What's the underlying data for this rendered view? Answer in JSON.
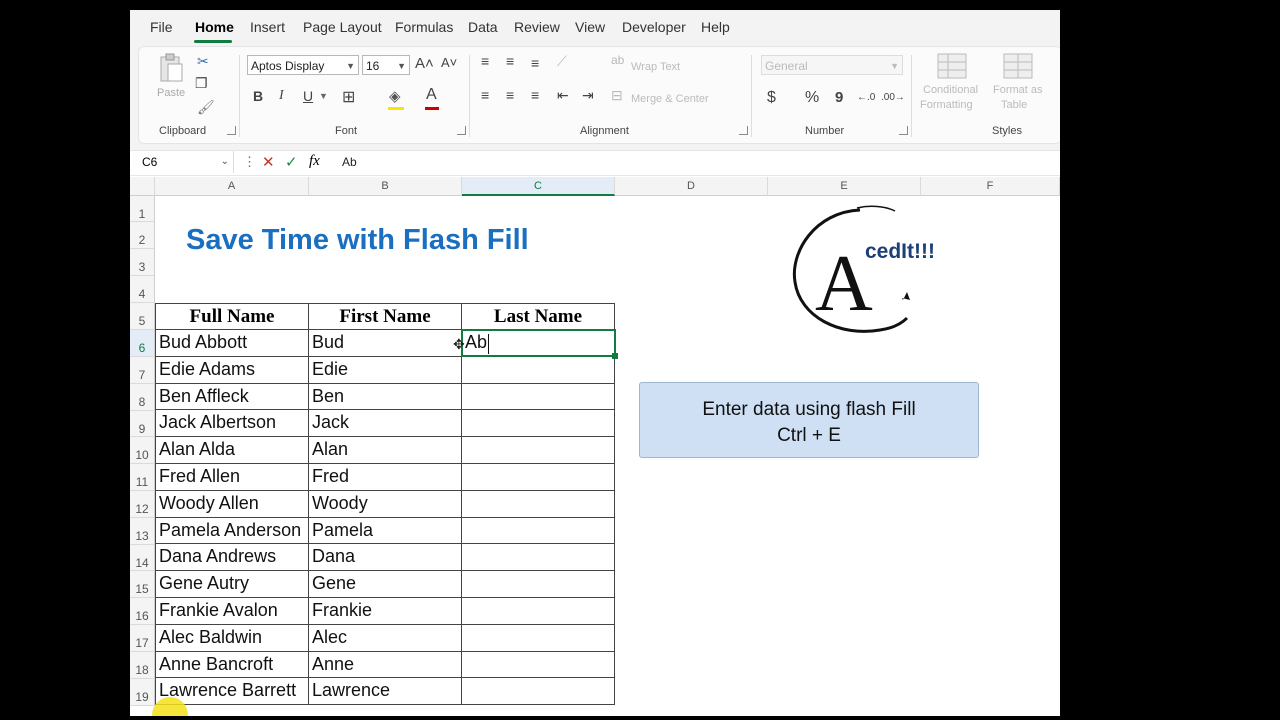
{
  "menu": {
    "tabs": [
      "File",
      "Home",
      "Insert",
      "Page Layout",
      "Formulas",
      "Data",
      "Review",
      "View",
      "Developer",
      "Help"
    ],
    "active": "Home"
  },
  "ribbon": {
    "clipboard": {
      "paste_label": "Paste",
      "group_label": "Clipboard"
    },
    "font": {
      "font_name": "Aptos Display",
      "font_size": "16",
      "bold": "B",
      "italic": "I",
      "underline": "U",
      "group_label": "Font"
    },
    "alignment": {
      "wrap_text": "Wrap Text",
      "merge_center": "Merge & Center",
      "group_label": "Alignment"
    },
    "number": {
      "format": "General",
      "currency": "$",
      "percent": "%",
      "comma": "9",
      "group_label": "Number"
    },
    "styles": {
      "conditional_line1": "Conditional",
      "conditional_line2": "Formatting",
      "format_table_line1": "Format as",
      "format_table_line2": "Table",
      "group_label": "Styles"
    }
  },
  "formula_bar": {
    "name_box": "C6",
    "cancel": "✕",
    "enter": "✓",
    "fx": "fx",
    "formula": "Ab"
  },
  "columns": [
    "A",
    "B",
    "C",
    "D",
    "E",
    "F"
  ],
  "rows": [
    "1",
    "2",
    "3",
    "4",
    "5",
    "6",
    "7",
    "8",
    "9",
    "10",
    "11",
    "12",
    "13",
    "14",
    "15",
    "16",
    "17",
    "18",
    "19"
  ],
  "sheet": {
    "title": "Save Time with Flash Fill",
    "headers": [
      "Full Name",
      "First Name",
      "Last Name"
    ],
    "data": [
      {
        "full": "Bud Abbott",
        "first": "Bud",
        "last": "Ab"
      },
      {
        "full": "Edie Adams",
        "first": "Edie",
        "last": ""
      },
      {
        "full": "Ben Affleck",
        "first": "Ben",
        "last": ""
      },
      {
        "full": "Jack Albertson",
        "first": "Jack",
        "last": ""
      },
      {
        "full": "Alan Alda",
        "first": "Alan",
        "last": ""
      },
      {
        "full": "Fred Allen",
        "first": "Fred",
        "last": ""
      },
      {
        "full": "Woody Allen",
        "first": "Woody",
        "last": ""
      },
      {
        "full": "Pamela Anderson",
        "first": "Pamela",
        "last": ""
      },
      {
        "full": "Dana Andrews",
        "first": "Dana",
        "last": ""
      },
      {
        "full": "Gene Autry",
        "first": "Gene",
        "last": ""
      },
      {
        "full": "Frankie Avalon",
        "first": "Frankie",
        "last": ""
      },
      {
        "full": "Alec Baldwin",
        "first": "Alec",
        "last": ""
      },
      {
        "full": "Anne Bancroft",
        "first": "Anne",
        "last": ""
      },
      {
        "full": "Lawrence Barrett",
        "first": "Lawrence",
        "last": ""
      }
    ]
  },
  "logo": {
    "letter": "A",
    "text": "cedIt!!!"
  },
  "callout": {
    "line1": "Enter data using flash Fill",
    "line2": "Ctrl + E"
  },
  "colors": {
    "accent": "#107c41",
    "title": "#1a6fc0",
    "callout_bg": "#cfe0f5"
  }
}
